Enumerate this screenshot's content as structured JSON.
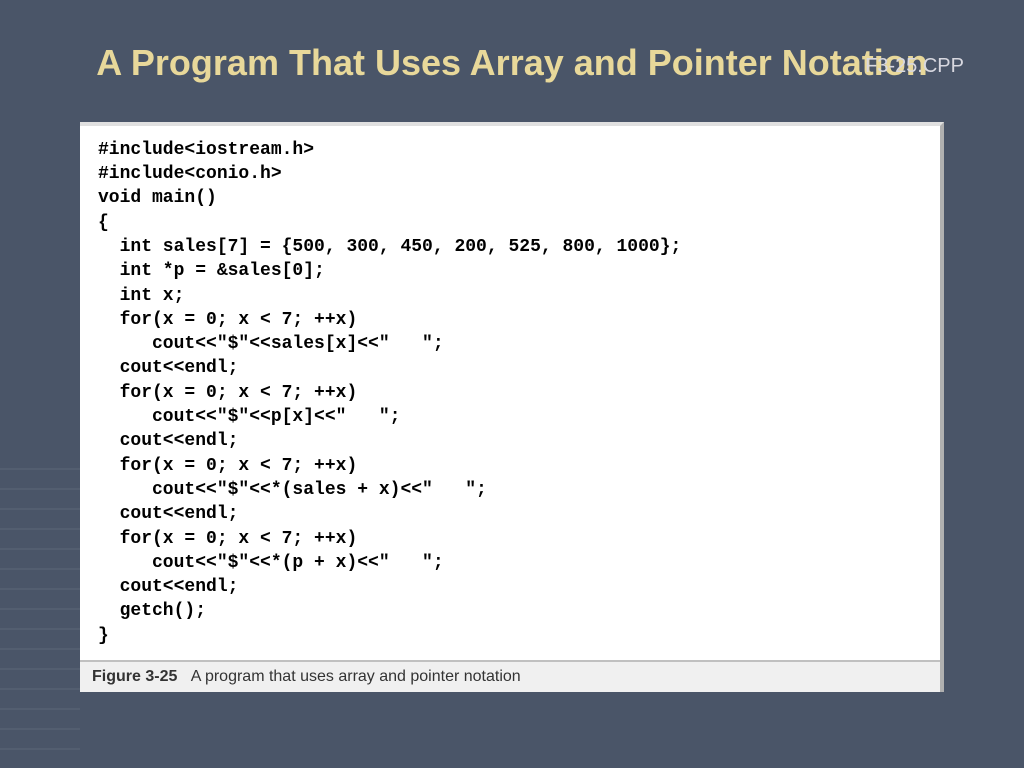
{
  "title": "A Program That Uses Array and Pointer Notation",
  "filename": "F3-25.CPP",
  "code": "#include<iostream.h>\n#include<conio.h>\nvoid main()\n{\n  int sales[7] = {500, 300, 450, 200, 525, 800, 1000};\n  int *p = &sales[0];\n  int x;\n  for(x = 0; x < 7; ++x)\n     cout<<\"$\"<<sales[x]<<\"   \";\n  cout<<endl;\n  for(x = 0; x < 7; ++x)\n     cout<<\"$\"<<p[x]<<\"   \";\n  cout<<endl;\n  for(x = 0; x < 7; ++x)\n     cout<<\"$\"<<*(sales + x)<<\"   \";\n  cout<<endl;\n  for(x = 0; x < 7; ++x)\n     cout<<\"$\"<<*(p + x)<<\"   \";\n  cout<<endl;\n  getch();\n}",
  "caption_label": "Figure 3-25",
  "caption_text": "A program that uses array and pointer notation"
}
